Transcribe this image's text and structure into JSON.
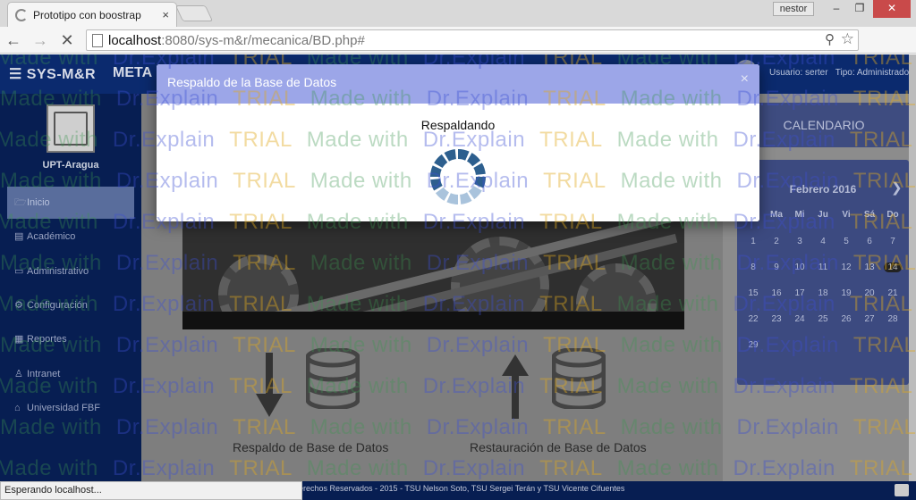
{
  "browser": {
    "tab_title": "Prototipo con boostrap",
    "tab_close": "×",
    "profile_name": "nestor",
    "url_host": "localhost",
    "url_path": ":8080/sys-m&r/mecanica/BD.php#",
    "status_text": "Esperando localhost...",
    "win_min": "–",
    "win_max": "❐",
    "win_close": "✕"
  },
  "app": {
    "brand": "SYS-M&R",
    "brand_partial": "META",
    "user_label": "Usuario: serter",
    "role_label": "Tipo: Administrador",
    "university": "UPT-Aragua",
    "sidebar": [
      {
        "label": "Inicio",
        "icon": "folder-open-icon",
        "glyph": "🗁"
      },
      {
        "label": "Académico",
        "icon": "book-icon",
        "glyph": "▤"
      },
      {
        "label": "Administrativo",
        "icon": "monitor-icon",
        "glyph": "▭"
      },
      {
        "label": "Configuración",
        "icon": "cogs-icon",
        "glyph": "⚙"
      },
      {
        "label": "Reportes",
        "icon": "document-icon",
        "glyph": "▦"
      },
      {
        "label": "Intranet",
        "icon": "sitemap-icon",
        "glyph": "♙"
      },
      {
        "label": "Universidad FBF",
        "icon": "institution-icon",
        "glyph": "⌂"
      }
    ],
    "backup_caption": "Respaldo de Base de Datos",
    "restore_caption": "Restauración de Base de Datos",
    "calendar_title": "CALENDARIO",
    "calendar": {
      "month": "Febrero 2016",
      "prev": "❮",
      "next": "❯",
      "dow": [
        "Lu",
        "Ma",
        "Mi",
        "Ju",
        "Vi",
        "Sá",
        "Do"
      ],
      "weeks": [
        [
          "1",
          "2",
          "3",
          "4",
          "5",
          "6",
          "7"
        ],
        [
          "8",
          "9",
          "10",
          "11",
          "12",
          "13",
          "14"
        ],
        [
          "15",
          "16",
          "17",
          "18",
          "19",
          "20",
          "21"
        ],
        [
          "22",
          "23",
          "24",
          "25",
          "26",
          "27",
          "28"
        ],
        [
          "29",
          "",
          "",
          "",
          "",
          "",
          ""
        ]
      ],
      "today": "14"
    },
    "footer": "erechos Reservados - 2015 - TSU Nelson Soto, TSU Sergei Terán y TSU Vicente Cifuentes"
  },
  "modal": {
    "title": "Respaldo de la Base de Datos",
    "close": "×",
    "message": "Respaldando"
  },
  "watermark": {
    "made_with": "Made with",
    "brand": "Dr.Explain",
    "trial": "TRIAL"
  },
  "colors": {
    "nav": "#0b2a6e",
    "modal_header": "#9ca6e8",
    "spinner_dark": "#2d5f8e",
    "spinner_light": "#a9c3dc"
  }
}
